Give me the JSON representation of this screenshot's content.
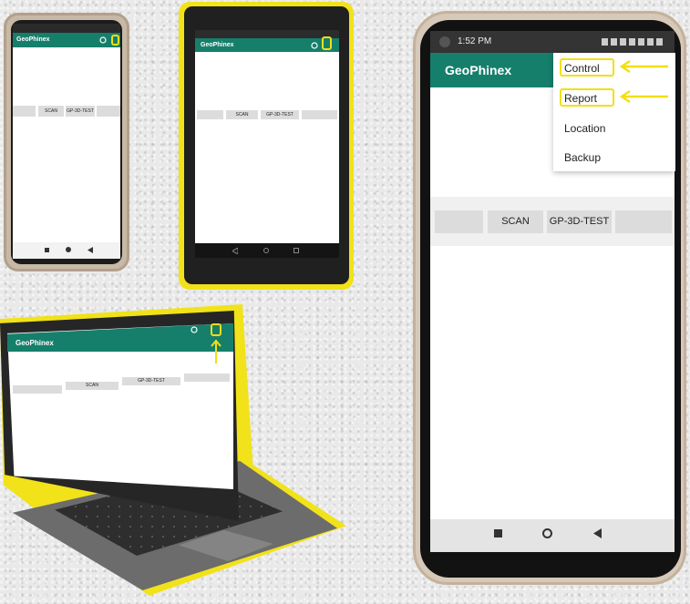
{
  "app": {
    "title": "GeoPhinex"
  },
  "buttons": {
    "scan": "SCAN",
    "test": "GP-3D-TEST"
  },
  "menu": {
    "items": [
      "Control",
      "Report",
      "Location",
      "Backup"
    ]
  },
  "big_phone": {
    "status_time": "1:52 PM"
  },
  "colors": {
    "appbar": "#157f6b",
    "highlight": "#f3df16",
    "button_bg": "#dcdcdc"
  },
  "icons": [
    "refresh-icon",
    "overflow-menu-icon",
    "arrow-up-icon",
    "arrow-left-icon",
    "square-nav-icon",
    "circle-nav-icon",
    "triangle-back-icon"
  ]
}
